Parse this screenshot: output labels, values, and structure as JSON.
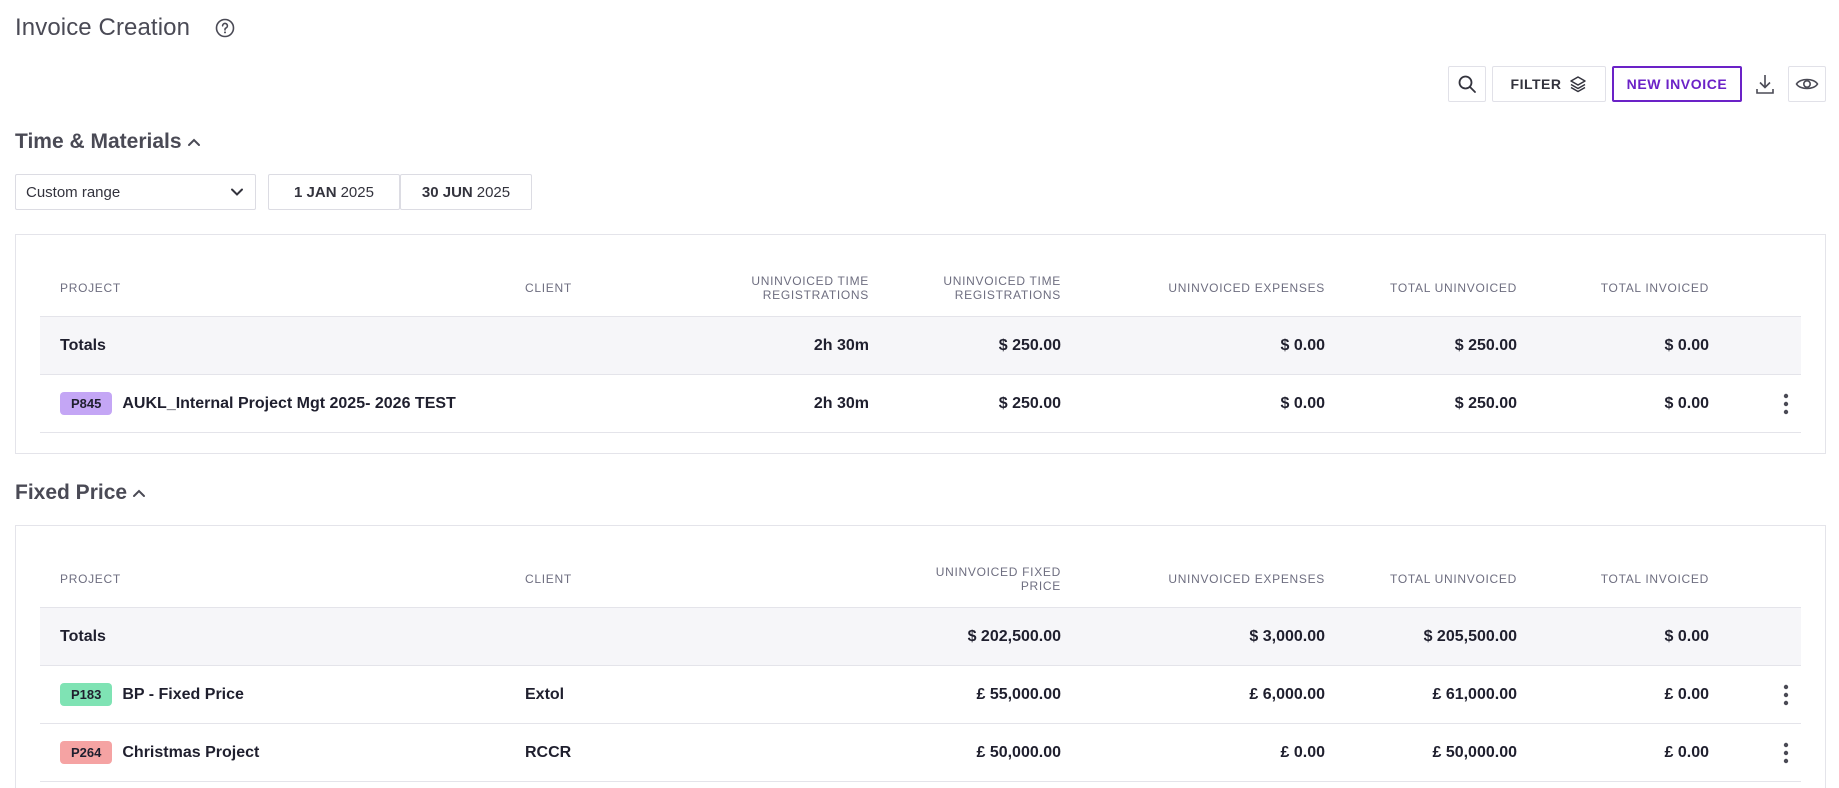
{
  "page": {
    "title": "Invoice Creation"
  },
  "toolbar": {
    "filter_label": "FILTER",
    "new_invoice_label": "NEW INVOICE"
  },
  "tm": {
    "title": "Time & Materials",
    "range_select": "Custom range",
    "start_date": {
      "day": "1 JAN",
      "year": "2025"
    },
    "end_date": {
      "day": "30 JUN",
      "year": "2025"
    },
    "headers": {
      "project": "PROJECT",
      "client": "CLIENT",
      "time_hours": "UNINVOICED TIME\nREGISTRATIONS",
      "time_amount": "UNINVOICED TIME\nREGISTRATIONS",
      "expenses": "UNINVOICED EXPENSES",
      "total_uninvoiced": "TOTAL UNINVOICED",
      "total_invoiced": "TOTAL INVOICED"
    },
    "totals": {
      "label": "Totals",
      "time_hours": "2h 30m",
      "time_amount": "$ 250.00",
      "expenses": "$ 0.00",
      "total_uninvoiced": "$ 250.00",
      "total_invoiced": "$ 0.00"
    },
    "rows": [
      {
        "badge": "P845",
        "badge_color": "#c4a6f5",
        "name": "AUKL_Internal Project Mgt 2025- 2026 TEST",
        "client": "",
        "time_hours": "2h 30m",
        "time_amount": "$ 250.00",
        "expenses": "$ 0.00",
        "total_uninvoiced": "$ 250.00",
        "total_invoiced": "$ 0.00"
      }
    ]
  },
  "fp": {
    "title": "Fixed Price",
    "headers": {
      "project": "PROJECT",
      "client": "CLIENT",
      "fixed_price": "UNINVOICED FIXED\nPRICE",
      "expenses": "UNINVOICED EXPENSES",
      "total_uninvoiced": "TOTAL UNINVOICED",
      "total_invoiced": "TOTAL INVOICED"
    },
    "totals": {
      "label": "Totals",
      "fixed_price": "$ 202,500.00",
      "expenses": "$ 3,000.00",
      "total_uninvoiced": "$ 205,500.00",
      "total_invoiced": "$ 0.00"
    },
    "rows": [
      {
        "badge": "P183",
        "badge_color": "#7fe3b4",
        "name": "BP - Fixed Price",
        "client": "Extol",
        "fixed_price": "£ 55,000.00",
        "expenses": "£ 6,000.00",
        "total_uninvoiced": "£ 61,000.00",
        "total_invoiced": "£ 0.00"
      },
      {
        "badge": "P264",
        "badge_color": "#f5a3a3",
        "name": "Christmas Project",
        "client": "RCCR",
        "fixed_price": "£ 50,000.00",
        "expenses": "£ 0.00",
        "total_uninvoiced": "£ 50,000.00",
        "total_invoiced": "£ 0.00"
      }
    ]
  }
}
